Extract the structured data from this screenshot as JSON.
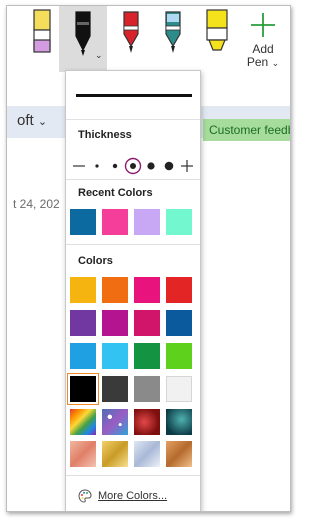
{
  "ribbon": {
    "add_pen_label_1": "Add",
    "add_pen_label_2": "Pen",
    "colors": {
      "pink_highlighter": "#d39ce0",
      "black_pen": "#111111",
      "red_pen": "#d8232a",
      "teal_pen": "#2c8c8a",
      "yellow_highlighter": "#f3e21c"
    }
  },
  "background": {
    "left_tab_text": "oft",
    "green_tab_text": "Customer feedb",
    "date_fragment": "t 24, 202"
  },
  "pen_menu": {
    "thickness_title": "Thickness",
    "recent_colors_title": "Recent Colors",
    "colors_title": "Colors",
    "more_colors_label": "More Colors...",
    "recent_colors": [
      "#0d6aa0",
      "#f53d9a",
      "#c8a8f4",
      "#72f7cf"
    ],
    "color_grid": [
      [
        "#f5b410",
        "#f06d12",
        "#e9137e",
        "#e42526"
      ],
      [
        "#7138a1",
        "#b4148f",
        "#d0156a",
        "#0c5a9e"
      ],
      [
        "#1ea0e2",
        "#33c3f2",
        "#149343",
        "#5ed11d"
      ],
      [
        "#000000",
        "#3a3a3a",
        "#8a8a8a",
        "#f1f1f1"
      ]
    ],
    "selected_color": "black"
  }
}
